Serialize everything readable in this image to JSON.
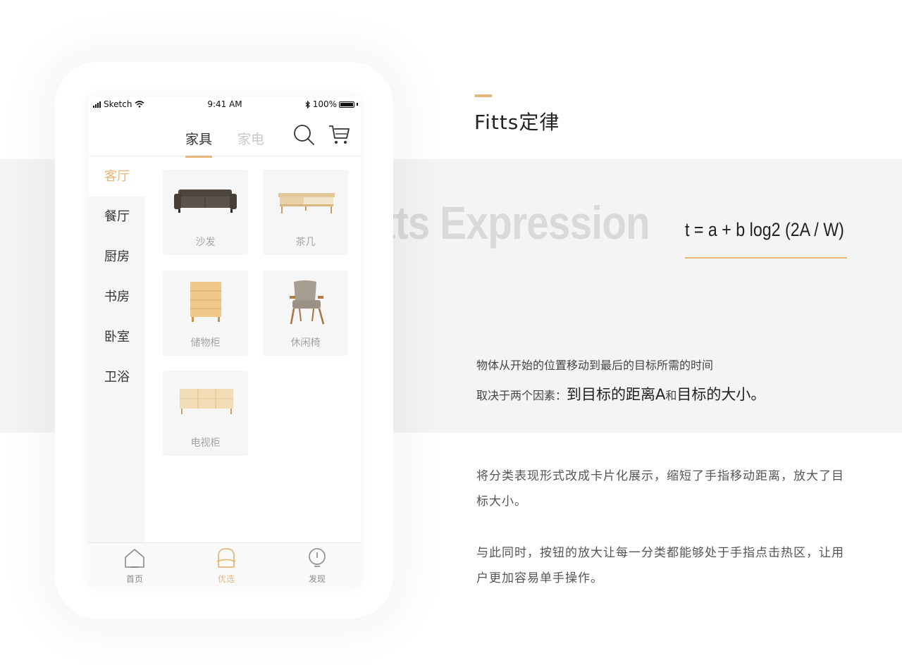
{
  "status_bar": {
    "carrier": "Sketch",
    "time": "9:41 AM",
    "battery": "100%"
  },
  "nav": {
    "tabs": [
      {
        "label": "家具",
        "active": true
      },
      {
        "label": "家电",
        "active": false
      }
    ],
    "search_icon": "search-icon",
    "cart_icon": "cart-icon"
  },
  "sidebar": {
    "items": [
      {
        "label": "客厅",
        "active": true
      },
      {
        "label": "餐厅",
        "active": false
      },
      {
        "label": "厨房",
        "active": false
      },
      {
        "label": "书房",
        "active": false
      },
      {
        "label": "卧室",
        "active": false
      },
      {
        "label": "卫浴",
        "active": false
      }
    ]
  },
  "products": [
    {
      "label": "沙发",
      "icon": "sofa-image"
    },
    {
      "label": "茶几",
      "icon": "coffee-table-image"
    },
    {
      "label": "储物柜",
      "icon": "cabinet-image"
    },
    {
      "label": "休闲椅",
      "icon": "armchair-image"
    },
    {
      "label": "电视柜",
      "icon": "tv-cabinet-image"
    }
  ],
  "tab_bar": {
    "items": [
      {
        "label": "首页",
        "icon": "home-icon",
        "active": false
      },
      {
        "label": "优选",
        "icon": "sofa-icon",
        "active": true
      },
      {
        "label": "发现",
        "icon": "bulb-icon",
        "active": false
      }
    ]
  },
  "slide": {
    "heading": "Fitts定律",
    "watermark": "Fitts Expression",
    "formula": "t = a + b log2 (2A / W)",
    "line1": "物体从开始的位置移动到最后的目标所需的时间",
    "line2_prefix": "取决于两个因素：",
    "line2_part1": "到目标的距离A",
    "line2_and": "和",
    "line2_part2": "目标的大小",
    "line2_end": "。",
    "paragraph1": "将分类表现形式改成卡片化展示，缩短了手指移动距离，放大了目标大小。",
    "paragraph2": "与此同时，按钮的放大让每一分类都能够处于手指点击热区，让用户更加容易单手操作。"
  },
  "colors": {
    "accent": "#e7b77a",
    "band": "#f4f4f5",
    "text": "#333333"
  }
}
